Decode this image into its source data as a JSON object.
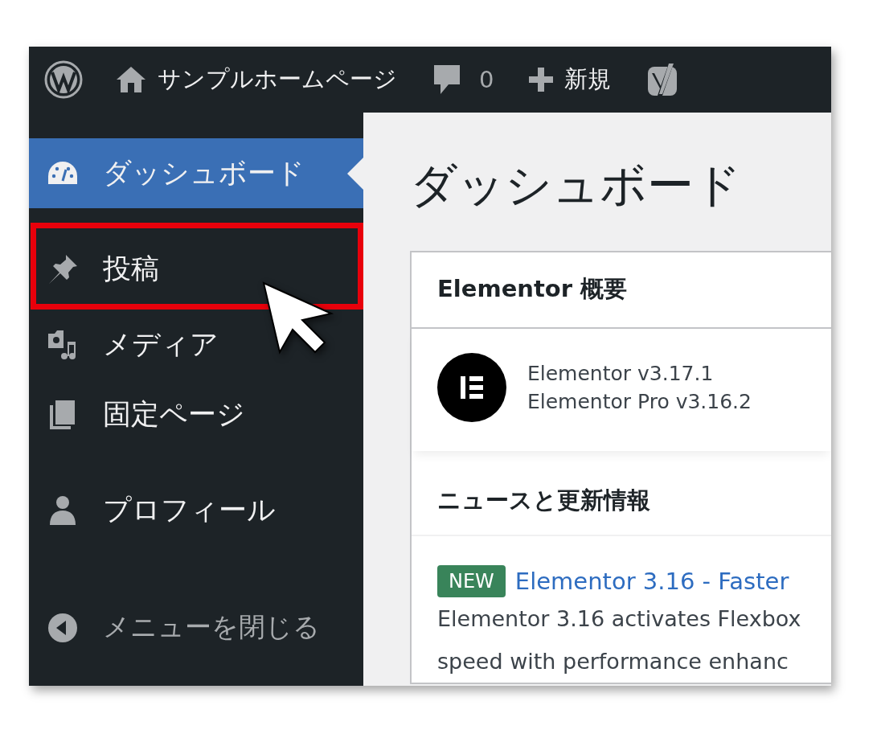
{
  "admin_bar": {
    "site_name": "サンプルホームページ",
    "comment_count": "0",
    "new_label": "新規"
  },
  "sidebar": {
    "groups": [
      [
        {
          "label": "ダッシュボード",
          "selected": true,
          "highlighted": false
        }
      ],
      [
        {
          "label": "投稿",
          "selected": false,
          "highlighted": true
        },
        {
          "label": "メディア",
          "selected": false,
          "highlighted": false
        },
        {
          "label": "固定ページ",
          "selected": false,
          "highlighted": false
        }
      ],
      [
        {
          "label": "プロフィール",
          "selected": false,
          "highlighted": false
        }
      ]
    ],
    "collapse_label": "メニューを閉じる"
  },
  "page_title": "ダッシュボード",
  "widget": {
    "title": "Elementor 概要",
    "versions": [
      "Elementor v3.17.1",
      "Elementor Pro v3.16.2"
    ],
    "news_title": "ニュースと更新情報",
    "news": [
      {
        "badge": "NEW",
        "title": "Elementor 3.16 - Faster",
        "excerpt": [
          "Elementor 3.16 activates Flexbox",
          "speed with performance enhanc"
        ]
      }
    ]
  }
}
